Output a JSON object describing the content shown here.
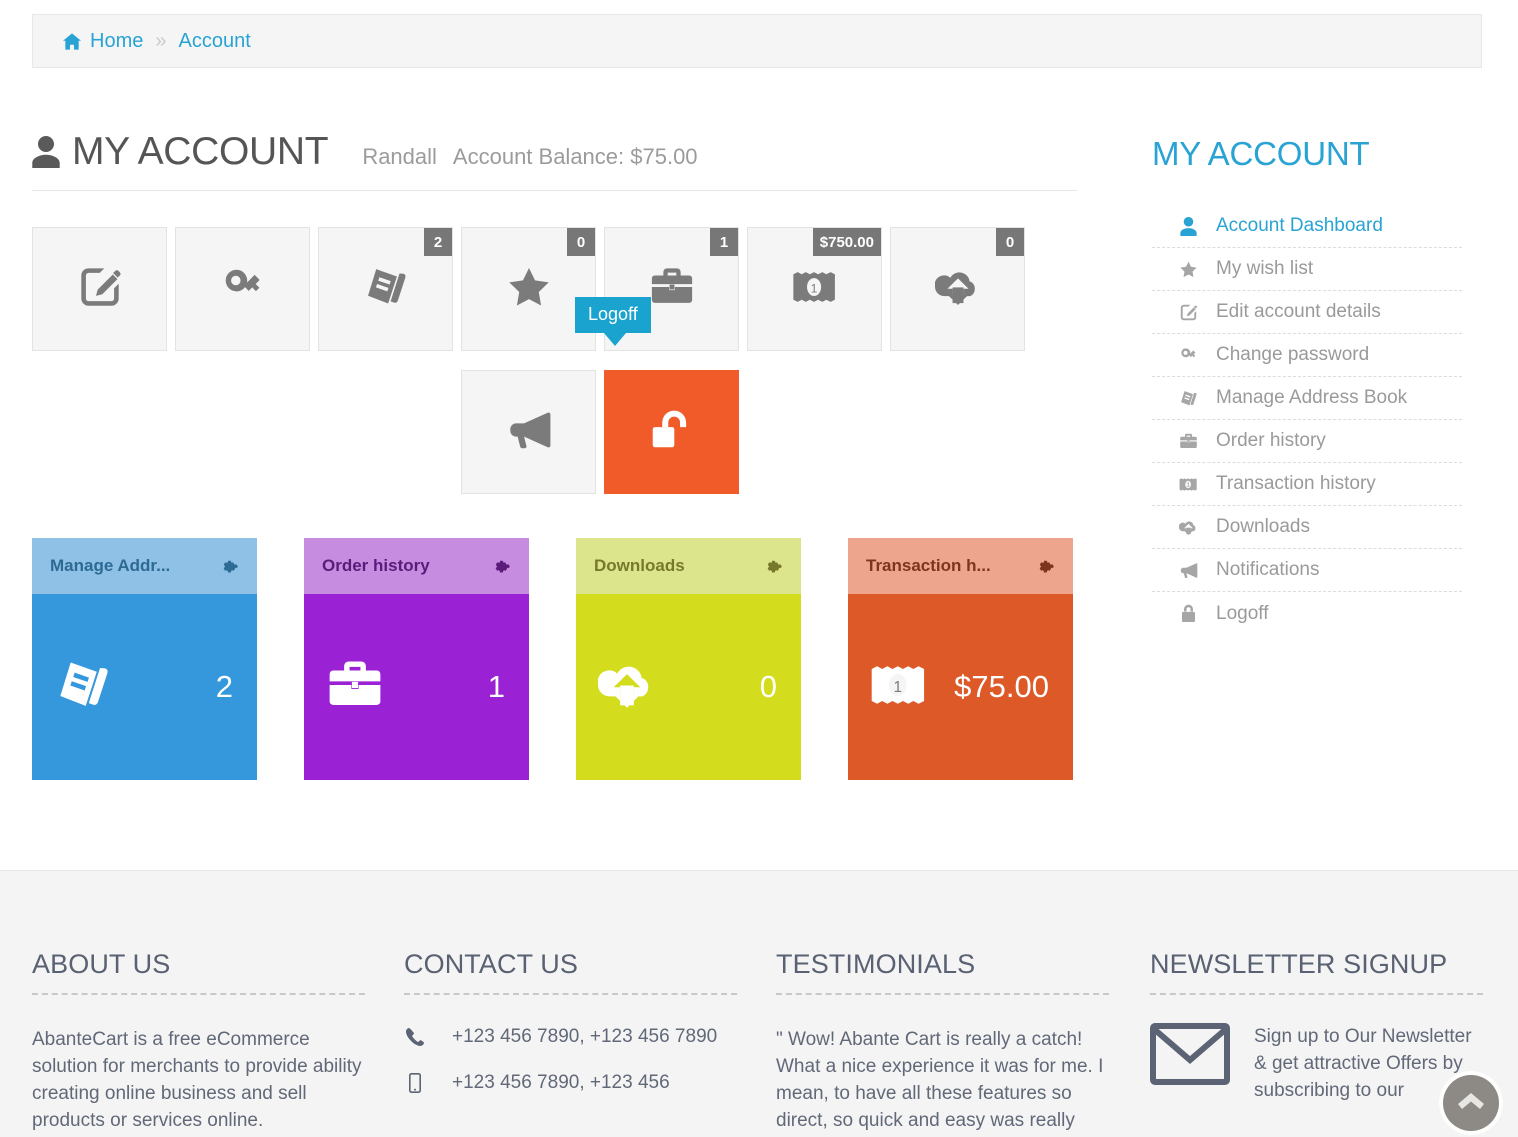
{
  "breadcrumb": {
    "home_icon": "home-icon",
    "home": "Home",
    "separator": "»",
    "current": "Account"
  },
  "account": {
    "title": "MY ACCOUNT",
    "user_icon": "user-icon",
    "username": "Randall",
    "balance_label": "Account Balance: $75.00"
  },
  "icon_tiles": [
    {
      "name": "edit-account-details",
      "icon": "pencil-square-icon",
      "badge": null,
      "active": false
    },
    {
      "name": "change-password",
      "icon": "key-icon",
      "badge": null,
      "active": false
    },
    {
      "name": "manage-address-book",
      "icon": "book-icon",
      "badge": "2",
      "active": false
    },
    {
      "name": "my-wish-list",
      "icon": "star-icon",
      "badge": "0",
      "active": false
    },
    {
      "name": "order-history",
      "icon": "briefcase-icon",
      "badge": "1",
      "active": false
    },
    {
      "name": "transaction-history",
      "icon": "money-icon",
      "badge": "$750.00",
      "active": false
    },
    {
      "name": "downloads",
      "icon": "cloud-download-icon",
      "badge": "0",
      "active": false
    },
    {
      "name": "notifications",
      "icon": "megaphone-icon",
      "badge": null,
      "active": false
    },
    {
      "name": "logoff",
      "icon": "unlock-icon",
      "badge": null,
      "active": true
    }
  ],
  "tooltip": {
    "label": "Logoff"
  },
  "stat_tiles": [
    {
      "name": "manage-address-book",
      "title": "Manage Addr...",
      "value": "2",
      "icon": "book-icon",
      "gear_icon": "gear-icon",
      "head_color": "#8ec1e5",
      "body_color": "#3598dc",
      "title_color": "#2d6a94"
    },
    {
      "name": "order-history",
      "title": "Order history",
      "value": "1",
      "icon": "briefcase-icon",
      "gear_icon": "gear-icon",
      "head_color": "#c58ce0",
      "body_color": "#9b21d4",
      "title_color": "#5b1b7a"
    },
    {
      "name": "downloads",
      "title": "Downloads",
      "value": "0",
      "icon": "cloud-download-icon",
      "gear_icon": "gear-icon",
      "head_color": "#dde58c",
      "body_color": "#d4dd1d",
      "title_color": "#76792b"
    },
    {
      "name": "transaction-history",
      "title": "Transaction h...",
      "value": "$75.00",
      "icon": "money-icon",
      "gear_icon": "gear-icon",
      "head_color": "#eda68d",
      "body_color": "#dd5a28",
      "title_color": "#7d3520"
    }
  ],
  "sidebar": {
    "title": "MY ACCOUNT",
    "items": [
      {
        "name": "account-dashboard",
        "label": "Account Dashboard",
        "icon": "user-icon",
        "active": true
      },
      {
        "name": "my-wish-list",
        "label": "My wish list",
        "icon": "star-icon",
        "active": false
      },
      {
        "name": "edit-account-details",
        "label": "Edit account details",
        "icon": "pencil-square-icon",
        "active": false
      },
      {
        "name": "change-password",
        "label": "Change password",
        "icon": "key-icon",
        "active": false
      },
      {
        "name": "manage-address-book",
        "label": "Manage Address Book",
        "icon": "book-icon",
        "active": false
      },
      {
        "name": "order-history",
        "label": "Order history",
        "icon": "briefcase-icon",
        "active": false
      },
      {
        "name": "transaction-history",
        "label": "Transaction history",
        "icon": "money-icon",
        "active": false
      },
      {
        "name": "downloads",
        "label": "Downloads",
        "icon": "cloud-download-icon",
        "active": false
      },
      {
        "name": "notifications",
        "label": "Notifications",
        "icon": "megaphone-icon",
        "active": false
      },
      {
        "name": "logoff",
        "label": "Logoff",
        "icon": "lock-icon",
        "active": false
      }
    ]
  },
  "footer": {
    "about": {
      "heading": "ABOUT US",
      "text": "AbanteCart is a free eCommerce solution for merchants to provide ability creating online business and sell products or services online."
    },
    "contact": {
      "heading": "CONTACT US",
      "phone_icon": "phone-icon",
      "phone": "+123 456 7890, +123 456 7890",
      "mobile_icon": "mobile-icon",
      "mobile": "+123 456 7890, +123 456"
    },
    "testimonials": {
      "heading": "TESTIMONIALS",
      "text": "\" Wow! Abante Cart is really a catch! What a nice experience it was for me. I mean, to have all these features so direct, so quick and easy was really"
    },
    "newsletter": {
      "heading": "NEWSLETTER SIGNUP",
      "envelope_icon": "envelope-icon",
      "text": "Sign up to Our Newsletter & get attractive Offers by subscribing to our"
    }
  },
  "scroll_top": {
    "icon": "chevron-up-icon"
  }
}
